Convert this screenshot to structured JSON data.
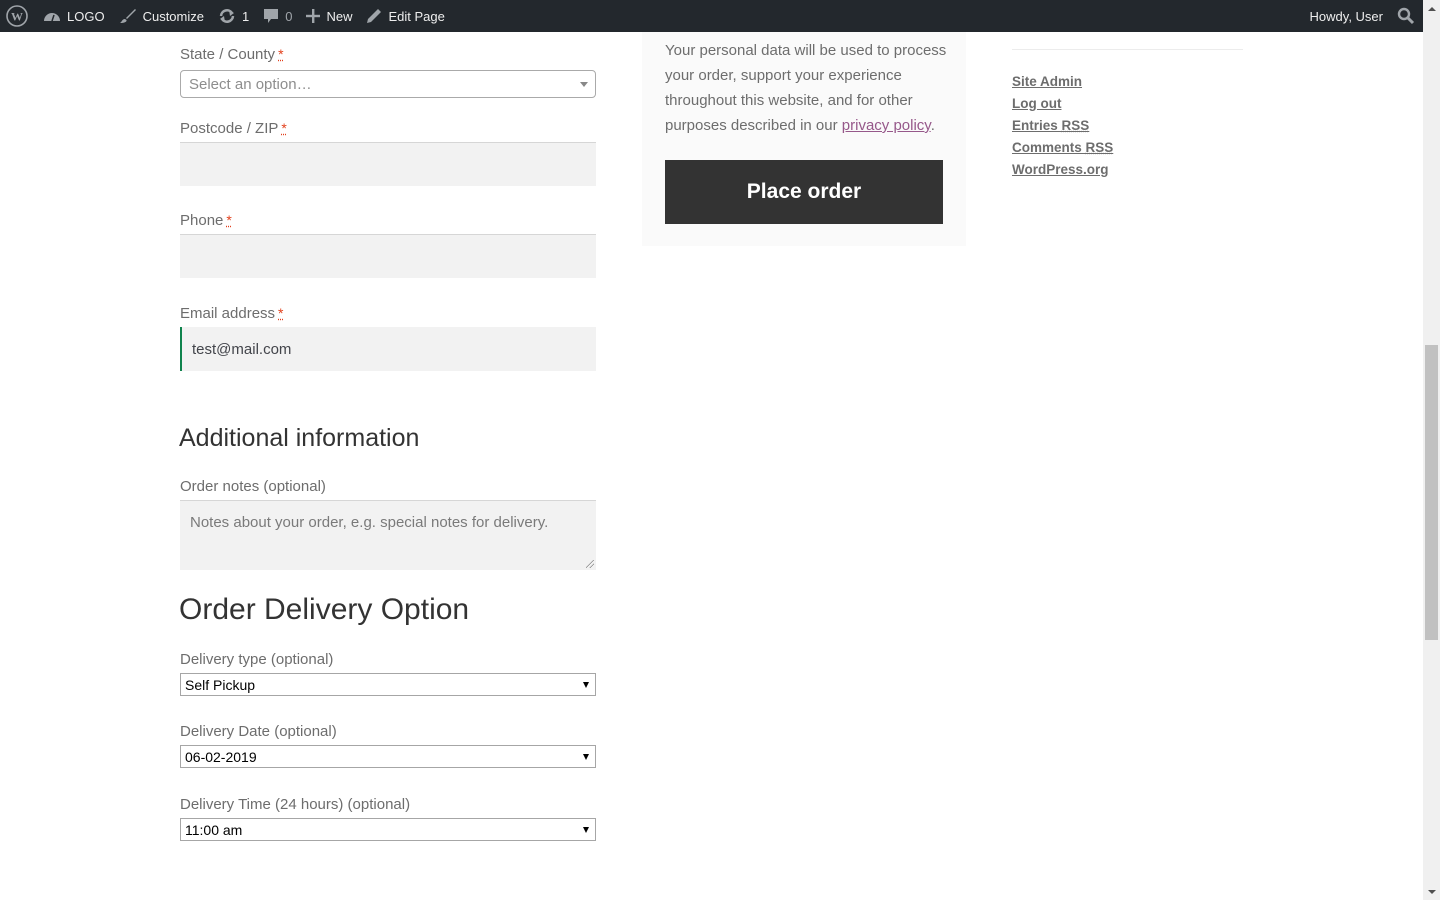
{
  "adminbar": {
    "items": [
      {
        "icon": "wordpress-logo-icon",
        "label": ""
      },
      {
        "icon": "dashboard-icon",
        "label": "LOGO"
      },
      {
        "icon": "brush-icon",
        "label": "Customize"
      },
      {
        "icon": "updates-icon",
        "label": "1"
      },
      {
        "icon": "comment-icon",
        "label": "0"
      },
      {
        "icon": "plus-icon",
        "label": "New"
      },
      {
        "icon": "pencil-icon",
        "label": "Edit Page"
      }
    ],
    "greeting": "Howdy, User",
    "search_icon": "search-icon"
  },
  "billing": {
    "state": {
      "label": "State / County",
      "required_mark": "*",
      "placeholder": "Select an option…"
    },
    "postcode": {
      "label": "Postcode / ZIP",
      "required_mark": "*",
      "value": ""
    },
    "phone": {
      "label": "Phone",
      "required_mark": "*",
      "value": ""
    },
    "email": {
      "label": "Email address",
      "required_mark": "*",
      "value": "test@mail.com"
    }
  },
  "additional": {
    "heading": "Additional information",
    "order_notes": {
      "label": "Order notes (optional)",
      "placeholder": "Notes about your order, e.g. special notes for delivery."
    }
  },
  "delivery": {
    "heading": "Order Delivery Option",
    "type": {
      "label": "Delivery type (optional)",
      "selected": "Self Pickup"
    },
    "date": {
      "label": "Delivery Date (optional)",
      "selected": "06-02-2019"
    },
    "time": {
      "label": "Delivery Time (24 hours) (optional)",
      "selected": "11:00 am"
    }
  },
  "review": {
    "privacy_text_before": "Your personal data will be used to process your order, support your experience throughout this website, and for other purposes described in our ",
    "privacy_link": "privacy policy",
    "privacy_text_after": ".",
    "place_order": "Place order"
  },
  "meta_widget": {
    "links": [
      {
        "text": "Site Admin"
      },
      {
        "text": "Log out"
      },
      {
        "text": "Entries ",
        "abbr": "RSS"
      },
      {
        "text": "Comments ",
        "abbr": "RSS"
      },
      {
        "text": "WordPress.org"
      }
    ]
  },
  "colors": {
    "adminbar_bg": "#23282d",
    "required": "#e2401c",
    "valid_border": "#0f834d",
    "link_purple": "#96588a",
    "button_bg": "#333333"
  }
}
